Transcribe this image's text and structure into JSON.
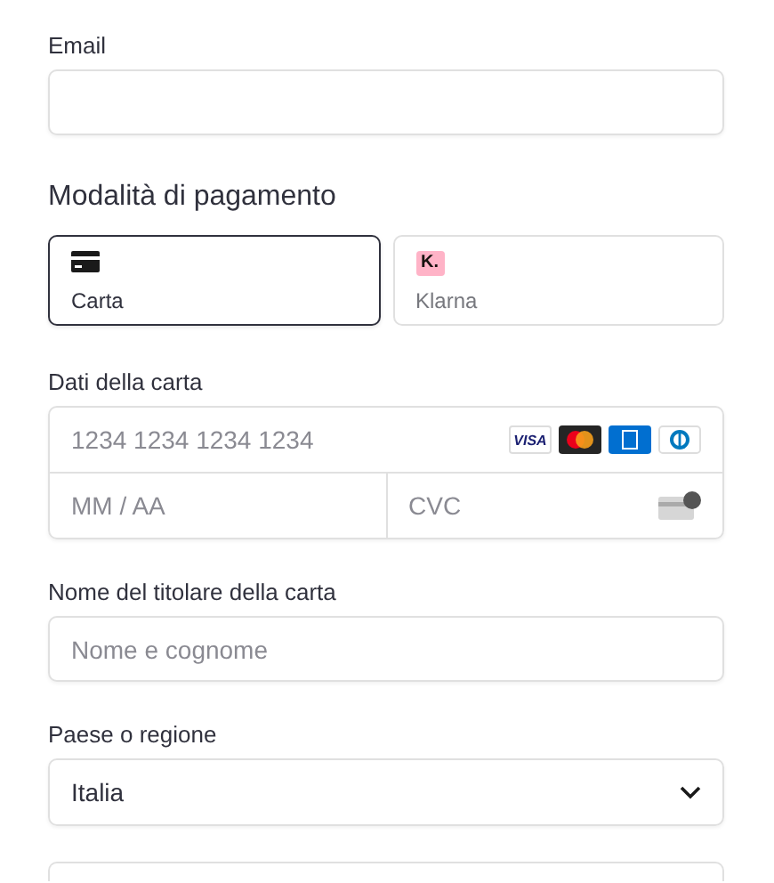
{
  "email": {
    "label": "Email"
  },
  "payment_method": {
    "title": "Modalità di pagamento",
    "tabs": [
      {
        "kind": "card",
        "label": "Carta",
        "selected": true
      },
      {
        "kind": "klarna",
        "badge": "K.",
        "label": "Klarna",
        "selected": false
      }
    ]
  },
  "card_details": {
    "label": "Dati della carta",
    "number_placeholder": "1234 1234 1234 1234",
    "brands": [
      {
        "kind": "visa",
        "text": "VISA"
      },
      {
        "kind": "mastercard"
      },
      {
        "kind": "amex"
      },
      {
        "kind": "diners"
      }
    ],
    "expiry_placeholder": "MM / AA",
    "cvc_placeholder": "CVC"
  },
  "cardholder": {
    "label": "Nome del titolare della carta",
    "placeholder": "Nome e cognome"
  },
  "country": {
    "label": "Paese o regione",
    "value": "Italia"
  }
}
